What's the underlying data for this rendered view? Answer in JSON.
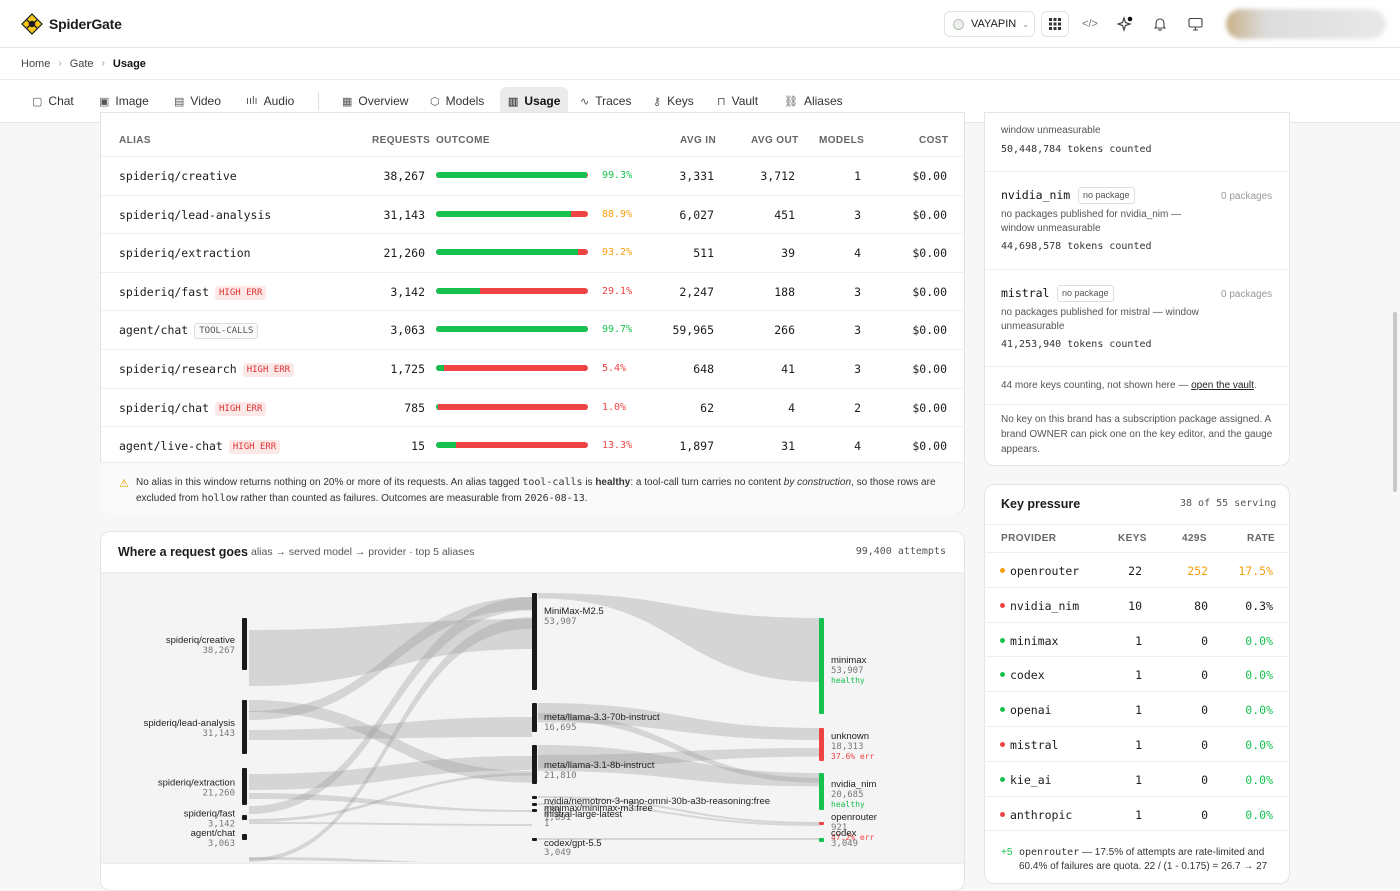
{
  "app": {
    "name": "SpiderGate",
    "org": "VAYAPIN"
  },
  "breadcrumb": [
    "Home",
    "Gate",
    "Usage"
  ],
  "tabs": [
    {
      "label": "Chat",
      "icon": "chat-icon"
    },
    {
      "label": "Image",
      "icon": "image-icon"
    },
    {
      "label": "Video",
      "icon": "video-icon"
    },
    {
      "label": "Audio",
      "icon": "audio-icon"
    },
    {
      "label": "Overview",
      "icon": "grid-icon"
    },
    {
      "label": "Models",
      "icon": "cube-icon"
    },
    {
      "label": "Usage",
      "icon": "bar-chart-icon",
      "active": true
    },
    {
      "label": "Traces",
      "icon": "pulse-icon"
    },
    {
      "label": "Keys",
      "icon": "key-icon"
    },
    {
      "label": "Vault",
      "icon": "lock-icon"
    },
    {
      "label": "Aliases",
      "icon": "link-icon"
    }
  ],
  "alias_table": {
    "headers": {
      "alias": "ALIAS",
      "requests": "REQUESTS",
      "outcome": "OUTCOME",
      "avg_in": "AVG IN",
      "avg_out": "AVG OUT",
      "models": "MODELS",
      "cost": "COST"
    },
    "rows": [
      {
        "alias": "spideriq/creative",
        "badge": "",
        "requests": "38,267",
        "ok_fraction": 0.993,
        "outcome": "99.3%",
        "outcome_color": "#16c150",
        "avg_in": "3,331",
        "avg_out": "3,712",
        "models": "1",
        "cost": "$0.00"
      },
      {
        "alias": "spideriq/lead-analysis",
        "badge": "",
        "requests": "31,143",
        "ok_fraction": 0.889,
        "outcome": "88.9%",
        "outcome_color": "#f59e0b",
        "avg_in": "6,027",
        "avg_out": "451",
        "models": "3",
        "cost": "$0.00"
      },
      {
        "alias": "spideriq/extraction",
        "badge": "",
        "requests": "21,260",
        "ok_fraction": 0.932,
        "outcome": "93.2%",
        "outcome_color": "#f59e0b",
        "avg_in": "511",
        "avg_out": "39",
        "models": "4",
        "cost": "$0.00"
      },
      {
        "alias": "spideriq/fast",
        "badge": "HIGH ERR",
        "badge_type": "err",
        "requests": "3,142",
        "ok_fraction": 0.291,
        "outcome": "29.1%",
        "outcome_color": "#ef4444",
        "avg_in": "2,247",
        "avg_out": "188",
        "models": "3",
        "cost": "$0.00"
      },
      {
        "alias": "agent/chat",
        "badge": "TOOL-CALLS",
        "badge_type": "tool",
        "requests": "3,063",
        "ok_fraction": 0.997,
        "outcome": "99.7%",
        "outcome_color": "#16c150",
        "avg_in": "59,965",
        "avg_out": "266",
        "models": "3",
        "cost": "$0.00"
      },
      {
        "alias": "spideriq/research",
        "badge": "HIGH ERR",
        "badge_type": "err",
        "requests": "1,725",
        "ok_fraction": 0.054,
        "outcome": "5.4%",
        "outcome_color": "#ef4444",
        "avg_in": "648",
        "avg_out": "41",
        "models": "3",
        "cost": "$0.00"
      },
      {
        "alias": "spideriq/chat",
        "badge": "HIGH ERR",
        "badge_type": "err",
        "requests": "785",
        "ok_fraction": 0.01,
        "outcome": "1.0%",
        "outcome_color": "#ef4444",
        "avg_in": "62",
        "avg_out": "4",
        "models": "2",
        "cost": "$0.00"
      },
      {
        "alias": "agent/live-chat",
        "badge": "HIGH ERR",
        "badge_type": "err",
        "requests": "15",
        "ok_fraction": 0.133,
        "outcome": "13.3%",
        "outcome_color": "#ef4444",
        "avg_in": "1,897",
        "avg_out": "31",
        "models": "4",
        "cost": "$0.00"
      }
    ],
    "note_pre": "No alias in this window returns nothing on 20% or more of its requests. An alias tagged ",
    "note_code1": "tool-calls",
    "note_mid1": " is ",
    "note_bold": "healthy",
    "note_mid2": ": a tool-call turn carries no content ",
    "note_em": "by construction",
    "note_mid3": ", so those rows are excluded from ",
    "note_code2": "hollow",
    "note_mid4": " rather than counted as failures. Outcomes are measurable from ",
    "note_code3": "2026-08-13",
    "note_end": "."
  },
  "sankey": {
    "title": "Where a request goes",
    "subtitle": "alias → served model → provider · top 5 aliases",
    "attempts": "99,400 attempts",
    "aliases": [
      {
        "name": "spideriq/creative",
        "value": "38,267"
      },
      {
        "name": "spideriq/lead-analysis",
        "value": "31,143"
      },
      {
        "name": "spideriq/extraction",
        "value": "21,260"
      },
      {
        "name": "spideriq/fast",
        "value": "3,142"
      },
      {
        "name": "agent/chat",
        "value": "3,063"
      }
    ],
    "models": [
      {
        "name": "MiniMax-M2.5",
        "value": "53,907"
      },
      {
        "name": "meta/llama-3.3-70b-instruct",
        "value": "16,695"
      },
      {
        "name": "meta/llama-3.1-8b-instruct",
        "value": "21,810"
      },
      {
        "name": "nvidia/nemotron-3-nano-omni-30b-a3b-reasoning:free",
        "value": "480"
      },
      {
        "name": "minimax/minimax-m3:free",
        "value": "1,891"
      },
      {
        "name": "mistral-large-latest",
        "value": "1"
      },
      {
        "name": "codex/gpt-5.5",
        "value": "3,049"
      }
    ],
    "providers": [
      {
        "name": "minimax",
        "value": "53,907",
        "status": "healthy",
        "status_color": "#16c150"
      },
      {
        "name": "unknown",
        "value": "18,313",
        "status": "37.6% err",
        "status_color": "#ef4444"
      },
      {
        "name": "nvidia_nim",
        "value": "20,685",
        "status": "healthy",
        "status_color": "#16c150"
      },
      {
        "name": "openrouter",
        "value": "921",
        "status": "47.2% err",
        "status_color": "#ef4444"
      },
      {
        "name": "codex",
        "value": "3,049",
        "status": "",
        "status_color": "#16c150"
      }
    ]
  },
  "packages": {
    "top_line1": "window unmeasurable",
    "top_tokens": "50,448,784 tokens counted",
    "items": [
      {
        "name": "nvidia_nim",
        "tag": "no package",
        "count": "0 packages",
        "desc1": "no packages published for nvidia_nim —",
        "desc2": "window unmeasurable",
        "tokens": "44,698,578 tokens counted"
      },
      {
        "name": "mistral",
        "tag": "no package",
        "count": "0 packages",
        "desc1": "no packages published for mistral — window",
        "desc2": "unmeasurable",
        "tokens": "41,253,940 tokens counted"
      }
    ],
    "more_pre": "44 more keys counting, not shown here — ",
    "more_link": "open the vault",
    "more_post": ".",
    "owner_note": "No key on this brand has a subscription package assigned. A brand OWNER can pick one on the key editor, and the gauge appears."
  },
  "key_pressure": {
    "title": "Key pressure",
    "serving": "38 of 55 serving",
    "headers": {
      "provider": "PROVIDER",
      "keys": "KEYS",
      "r429": "429S",
      "rate": "RATE"
    },
    "rows": [
      {
        "provider": "openrouter",
        "dot": "#f59e0b",
        "keys": "22",
        "r429": "252",
        "r429_color": "#f59e0b",
        "rate": "17.5%",
        "rate_color": "#f59e0b"
      },
      {
        "provider": "nvidia_nim",
        "dot": "#ef4444",
        "keys": "10",
        "r429": "80",
        "r429_color": "#1c1c1c",
        "rate": "0.3%",
        "rate_color": "#1c1c1c"
      },
      {
        "provider": "minimax",
        "dot": "#16c150",
        "keys": "1",
        "r429": "0",
        "r429_color": "#1c1c1c",
        "rate": "0.0%",
        "rate_color": "#16c150"
      },
      {
        "provider": "codex",
        "dot": "#16c150",
        "keys": "1",
        "r429": "0",
        "r429_color": "#1c1c1c",
        "rate": "0.0%",
        "rate_color": "#16c150"
      },
      {
        "provider": "openai",
        "dot": "#16c150",
        "keys": "1",
        "r429": "0",
        "r429_color": "#1c1c1c",
        "rate": "0.0%",
        "rate_color": "#16c150"
      },
      {
        "provider": "mistral",
        "dot": "#ef4444",
        "keys": "1",
        "r429": "0",
        "r429_color": "#1c1c1c",
        "rate": "0.0%",
        "rate_color": "#16c150"
      },
      {
        "provider": "kie_ai",
        "dot": "#16c150",
        "keys": "1",
        "r429": "0",
        "r429_color": "#1c1c1c",
        "rate": "0.0%",
        "rate_color": "#16c150"
      },
      {
        "provider": "anthropic",
        "dot": "#ef4444",
        "keys": "1",
        "r429": "0",
        "r429_color": "#1c1c1c",
        "rate": "0.0%",
        "rate_color": "#16c150"
      }
    ],
    "footer_delta": "+5",
    "footer_code": "openrouter",
    "footer_text1": " — 17.5% of attempts are rate-limited and",
    "footer_text2": "60.4% of failures are quota. 22 / (1 - 0.175) = 26.7 → 27"
  },
  "colors": {
    "ok": "#16c150",
    "warn": "#f59e0b",
    "err": "#ef4444",
    "accent": "#f5c518"
  }
}
